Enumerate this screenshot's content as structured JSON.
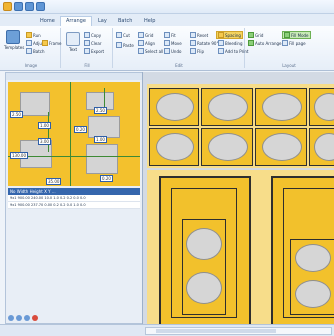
{
  "tabs": [
    "Home",
    "Arrange",
    "Lay",
    "Batch",
    "Help"
  ],
  "active_tab": "Arrange",
  "groups": [
    {
      "label": "Image"
    },
    {
      "label": "Fill"
    },
    {
      "label": "Edit"
    },
    {
      "label": "Layout"
    }
  ],
  "buttons": {
    "templates": "Templates",
    "run": "Run",
    "adjust": "Adjust",
    "batch": "Batch",
    "copy": "Copy",
    "clear": "Clear",
    "cut": "Cut",
    "grid": "Grid",
    "paste": "Paste",
    "align": "Align",
    "select_all": "Select all",
    "rotate": "Rotate 90°",
    "spacing": "Spacing",
    "bleeding": "Bleeding",
    "add_to_print": "Add to Print",
    "fit": "Fit",
    "undo": "Undo",
    "fill_mode": "Fill Mode",
    "auto_arrange": "Auto Arrange",
    "reset": "Reset",
    "flip": "Flip",
    "prev": "Prev",
    "next": "Next",
    "export": "Export",
    "frame": "Frame",
    "text": "Text",
    "fill_page": "Fill page",
    "move": "Move",
    "grid_check": "Grid"
  },
  "dims": [
    "2.50",
    "3.00",
    "2.50",
    "130.00",
    "1.00",
    "1.00",
    "0.20",
    "0.20",
    "35.00"
  ],
  "grid": {
    "header": "No  Width  Height  X  Y  ...",
    "rows": [
      "9x1 900.00 240.00 10.0 1.0 0.2 0.2 0.0 0.0",
      "9x1 900.00 237.70 0.00 0.2 0.2 0.0 1.0 0.0"
    ]
  },
  "colors": {
    "accent": "#3566ad",
    "card": "#f2c12c",
    "photo": "#d6d6d6"
  }
}
